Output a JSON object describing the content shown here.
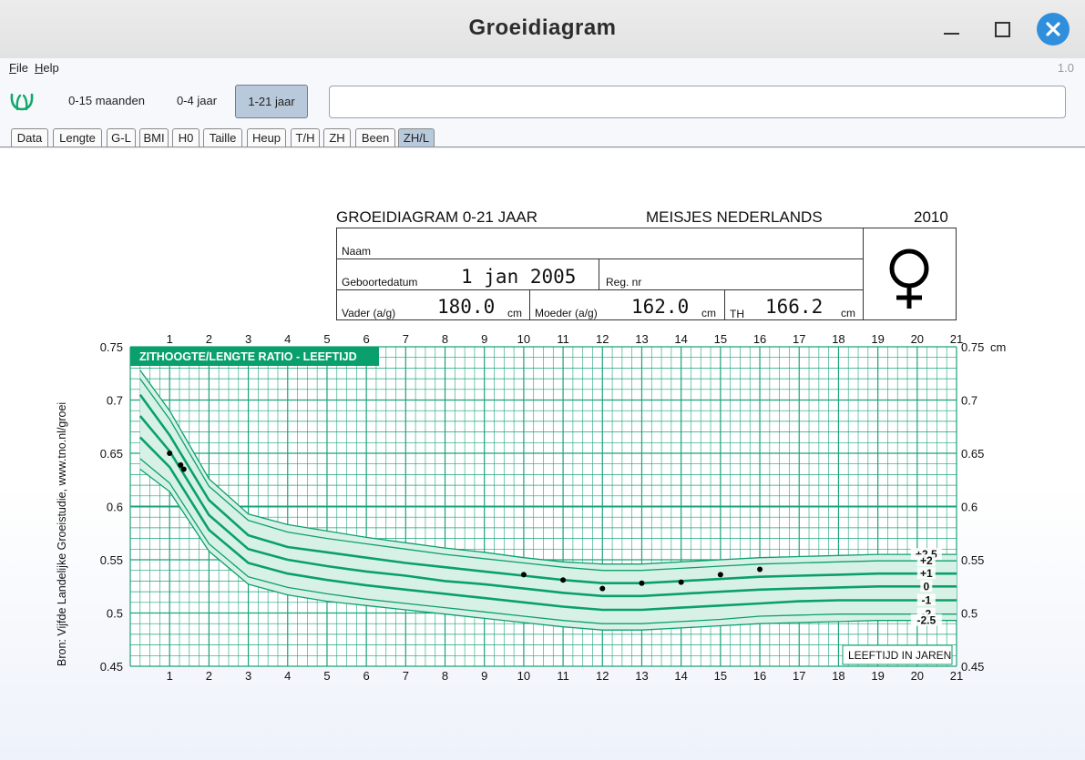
{
  "window": {
    "title": "Groeidiagram"
  },
  "menu": {
    "file": "File",
    "file_mnemonic": "F",
    "file_rest": "ile",
    "help": "Help",
    "help_mnemonic": "H",
    "help_rest": "elp",
    "version": "1.0"
  },
  "toolbar": {
    "ranges": [
      {
        "label": "0-15 maanden",
        "active": false
      },
      {
        "label": "0-4 jaar",
        "active": false
      },
      {
        "label": "1-21 jaar",
        "active": true
      }
    ],
    "input_value": ""
  },
  "tabs": [
    {
      "label": "Data"
    },
    {
      "label": "Lengte"
    },
    {
      "label": "G-L"
    },
    {
      "label": "BMI"
    },
    {
      "label": "H0"
    },
    {
      "label": "Taille"
    },
    {
      "label": "Heup"
    },
    {
      "label": "T/H"
    },
    {
      "label": "ZH"
    },
    {
      "label": "Been"
    },
    {
      "label": "ZH/L",
      "active": true
    }
  ],
  "header": {
    "left": "GROEIDIAGRAM 0-21 JAAR",
    "middle": "MEISJES  NEDERLANDS",
    "year": "2010"
  },
  "form": {
    "naam_label": "Naam",
    "geboortedatum_label": "Geboortedatum",
    "geboortedatum_value": "1 jan 2005",
    "regnr_label": "Reg. nr",
    "vader_label": "Vader (a/g)",
    "vader_value": "180.0",
    "moeder_label": "Moeder (a/g)",
    "moeder_value": "162.0",
    "th_label": "TH",
    "th_value": "166.2",
    "unit": "cm",
    "gender_symbol": "♀"
  },
  "chart_data": {
    "type": "line",
    "title": "ZITHOOGTE/LENGTE RATIO - LEEFTIJD",
    "xlabel": "LEEFTIJD IN JAREN",
    "ylabel": "",
    "ylabel_right_unit": "cm",
    "source_text": "Bron: Vijfde Landelijke Groeistudie, www.tno.nl/groei",
    "xlim": [
      0,
      21
    ],
    "ylim": [
      0.45,
      0.75
    ],
    "x_ticks": [
      1,
      2,
      3,
      4,
      5,
      6,
      7,
      8,
      9,
      10,
      11,
      12,
      13,
      14,
      15,
      16,
      17,
      18,
      19,
      20,
      21
    ],
    "y_ticks": [
      "0.45",
      "0.5",
      "0.55",
      "0.6",
      "0.65",
      "0.7",
      "0.75"
    ],
    "x": [
      0.25,
      1,
      2,
      3,
      4,
      5,
      6,
      7,
      8,
      9,
      10,
      11,
      12,
      13,
      14,
      15,
      16,
      17,
      18,
      19,
      20,
      21
    ],
    "series": [
      {
        "name": "+2.5",
        "values": [
          0.728,
          0.69,
          0.626,
          0.593,
          0.583,
          0.577,
          0.571,
          0.566,
          0.561,
          0.557,
          0.552,
          0.548,
          0.546,
          0.546,
          0.548,
          0.55,
          0.552,
          0.553,
          0.554,
          0.555,
          0.555,
          0.555
        ]
      },
      {
        "name": "+2",
        "values": [
          0.72,
          0.682,
          0.619,
          0.587,
          0.576,
          0.57,
          0.565,
          0.56,
          0.555,
          0.551,
          0.547,
          0.543,
          0.54,
          0.54,
          0.542,
          0.544,
          0.546,
          0.547,
          0.548,
          0.549,
          0.549,
          0.549
        ]
      },
      {
        "name": "+1",
        "values": [
          0.705,
          0.667,
          0.606,
          0.573,
          0.562,
          0.557,
          0.552,
          0.547,
          0.543,
          0.539,
          0.535,
          0.531,
          0.528,
          0.528,
          0.53,
          0.532,
          0.534,
          0.535,
          0.536,
          0.537,
          0.537,
          0.537
        ]
      },
      {
        "name": "0",
        "values": [
          0.685,
          0.652,
          0.592,
          0.56,
          0.55,
          0.544,
          0.539,
          0.535,
          0.53,
          0.527,
          0.523,
          0.519,
          0.516,
          0.516,
          0.518,
          0.52,
          0.522,
          0.523,
          0.524,
          0.525,
          0.525,
          0.525
        ]
      },
      {
        "name": "-1",
        "values": [
          0.665,
          0.637,
          0.578,
          0.547,
          0.537,
          0.531,
          0.526,
          0.522,
          0.518,
          0.514,
          0.51,
          0.506,
          0.503,
          0.503,
          0.505,
          0.507,
          0.509,
          0.511,
          0.512,
          0.512,
          0.512,
          0.512
        ]
      },
      {
        "name": "-2",
        "values": [
          0.645,
          0.622,
          0.565,
          0.534,
          0.524,
          0.518,
          0.513,
          0.509,
          0.505,
          0.501,
          0.497,
          0.493,
          0.49,
          0.49,
          0.492,
          0.494,
          0.497,
          0.498,
          0.499,
          0.499,
          0.499,
          0.499
        ]
      },
      {
        "name": "-2.5",
        "values": [
          0.635,
          0.614,
          0.558,
          0.527,
          0.517,
          0.511,
          0.507,
          0.503,
          0.499,
          0.495,
          0.491,
          0.487,
          0.484,
          0.484,
          0.486,
          0.488,
          0.49,
          0.491,
          0.492,
          0.493,
          0.493,
          0.493
        ]
      }
    ],
    "measurements": [
      {
        "x": 1.0,
        "y": 0.65
      },
      {
        "x": 1.28,
        "y": 0.639
      },
      {
        "x": 1.36,
        "y": 0.635
      },
      {
        "x": 10.0,
        "y": 0.536
      },
      {
        "x": 11.0,
        "y": 0.531
      },
      {
        "x": 12.0,
        "y": 0.523
      },
      {
        "x": 13.0,
        "y": 0.528
      },
      {
        "x": 14.0,
        "y": 0.529
      },
      {
        "x": 15.0,
        "y": 0.536
      },
      {
        "x": 16.0,
        "y": 0.541
      }
    ],
    "sd_labels": [
      "+2.5",
      "+2",
      "+1",
      "0",
      "-1",
      "-2",
      "-2.5"
    ],
    "colors": {
      "grid": "#1aa37a",
      "accent": "#0aa06e",
      "band": "#d8f1e6",
      "title_bg": "#0aa06e"
    }
  }
}
